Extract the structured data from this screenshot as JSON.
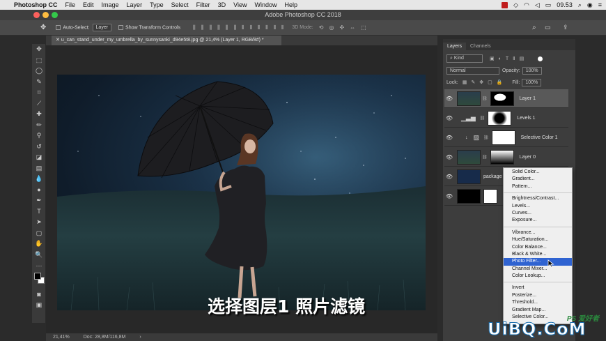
{
  "mac_menu": {
    "app_name": "Photoshop CC",
    "items": [
      "File",
      "Edit",
      "Image",
      "Layer",
      "Type",
      "Select",
      "Filter",
      "3D",
      "View",
      "Window",
      "Help"
    ],
    "clock": "09.53"
  },
  "window": {
    "title": "Adobe Photoshop CC 2018"
  },
  "options_bar": {
    "auto_select_label": "Auto-Select:",
    "auto_select_value": "Layer",
    "transform_label": "Show Transform Controls",
    "mode_3d_label": "3D Mode:"
  },
  "document": {
    "tab_title": "u_can_stand_under_my_umbrella_by_sunnysanki_d94e5t8.jpg @ 21,4% (Layer 1, RGB/8#) *",
    "zoom": "21,41%",
    "doc_size": "Doc: 28,8M/116,8M"
  },
  "subtitle": "选择图层1  照片滤镜",
  "panels": {
    "tabs": [
      "Layers",
      "Channels"
    ],
    "filter_label": "Kind",
    "blend_mode": "Normal",
    "opacity_label": "Opacity:",
    "opacity_value": "100%",
    "lock_label": "Lock:",
    "fill_label": "Fill:",
    "fill_value": "100%",
    "layers": [
      {
        "name": "Layer 1"
      },
      {
        "name": "Levels 1"
      },
      {
        "name": "Selective Color 1"
      },
      {
        "name": "Layer 0"
      },
      {
        "name": "package"
      },
      {
        "name": ""
      }
    ]
  },
  "adjust_menu": {
    "group1": [
      "Solid Color...",
      "Gradient...",
      "Pattern..."
    ],
    "group2": [
      "Brightness/Contrast...",
      "Levels...",
      "Curves...",
      "Exposure..."
    ],
    "group3": [
      "Vibrance...",
      "Hue/Saturation...",
      "Color Balance...",
      "Black & White...",
      "Photo Filter...",
      "Channel Mixer...",
      "Color Lookup..."
    ],
    "group4": [
      "Invert",
      "Posterize...",
      "Threshold...",
      "Gradient Map...",
      "Selective Color..."
    ],
    "highlighted": "Photo Filter..."
  },
  "watermark": {
    "text": "UiBQ.CoM",
    "small": "PS 爱好者"
  }
}
